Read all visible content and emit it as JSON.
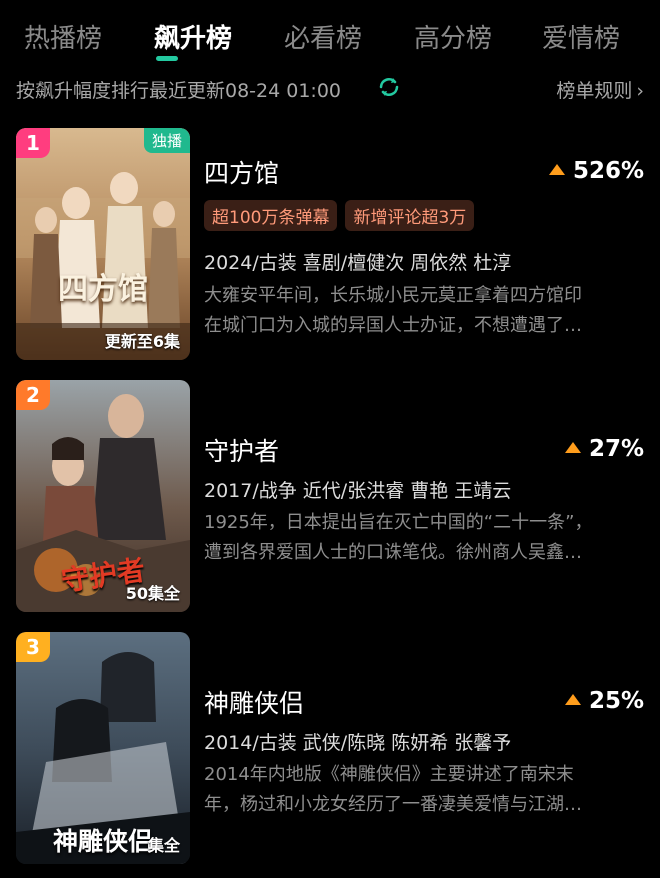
{
  "tabs": [
    {
      "label": "热播榜",
      "active": false
    },
    {
      "label": "飙升榜",
      "active": true
    },
    {
      "label": "必看榜",
      "active": false
    },
    {
      "label": "高分榜",
      "active": false
    },
    {
      "label": "爱情榜",
      "active": false
    }
  ],
  "accent_color": "#23c9a0",
  "trend_color": "#ff9d1c",
  "subheader": {
    "description": "按飙升幅度排行最近更新08-24 01:00",
    "rules_label": "榜单规则",
    "refresh_icon": "refresh-icon",
    "rules_icon": "chevron-right-icon"
  },
  "items": [
    {
      "rank": "1",
      "rank_color": "#ff3d7f",
      "title": "四方馆",
      "trend": "526%",
      "exclusive_badge": "独播",
      "episodes": "更新至6集",
      "poster_title": "四方馆",
      "tags": [
        "超100万条弹幕",
        "新增评论超3万"
      ],
      "meta": "2024/古装  喜剧/檀健次  周依然  杜淳",
      "description_lines": [
        "大雍安平年间，长乐城小民元莫正拿着四方馆印",
        "在城门口为入城的异国人士办证，不想遭遇了…"
      ]
    },
    {
      "rank": "2",
      "rank_color": "#ff7a2a",
      "title": "守护者",
      "trend": "27%",
      "episodes": "50集全",
      "poster_title": "守护者",
      "meta": "2017/战争  近代/张洪睿  曹艳  王靖云",
      "description_lines": [
        "1925年，日本提出旨在灭亡中国的“二十一条”，",
        "遭到各界爱国人士的口诛笔伐。徐州商人吴鑫…"
      ]
    },
    {
      "rank": "3",
      "rank_color": "#ffb020",
      "title": "神雕侠侣",
      "trend": "25%",
      "episodes": "集全",
      "poster_title": "神雕侠侣",
      "meta": "2014/古装  武侠/陈晓  陈妍希  张馨予",
      "description_lines": [
        "2014年内地版《神雕侠侣》主要讲述了南宋末",
        "年，杨过和小龙女经历了一番凄美爱情与江湖…"
      ]
    }
  ]
}
